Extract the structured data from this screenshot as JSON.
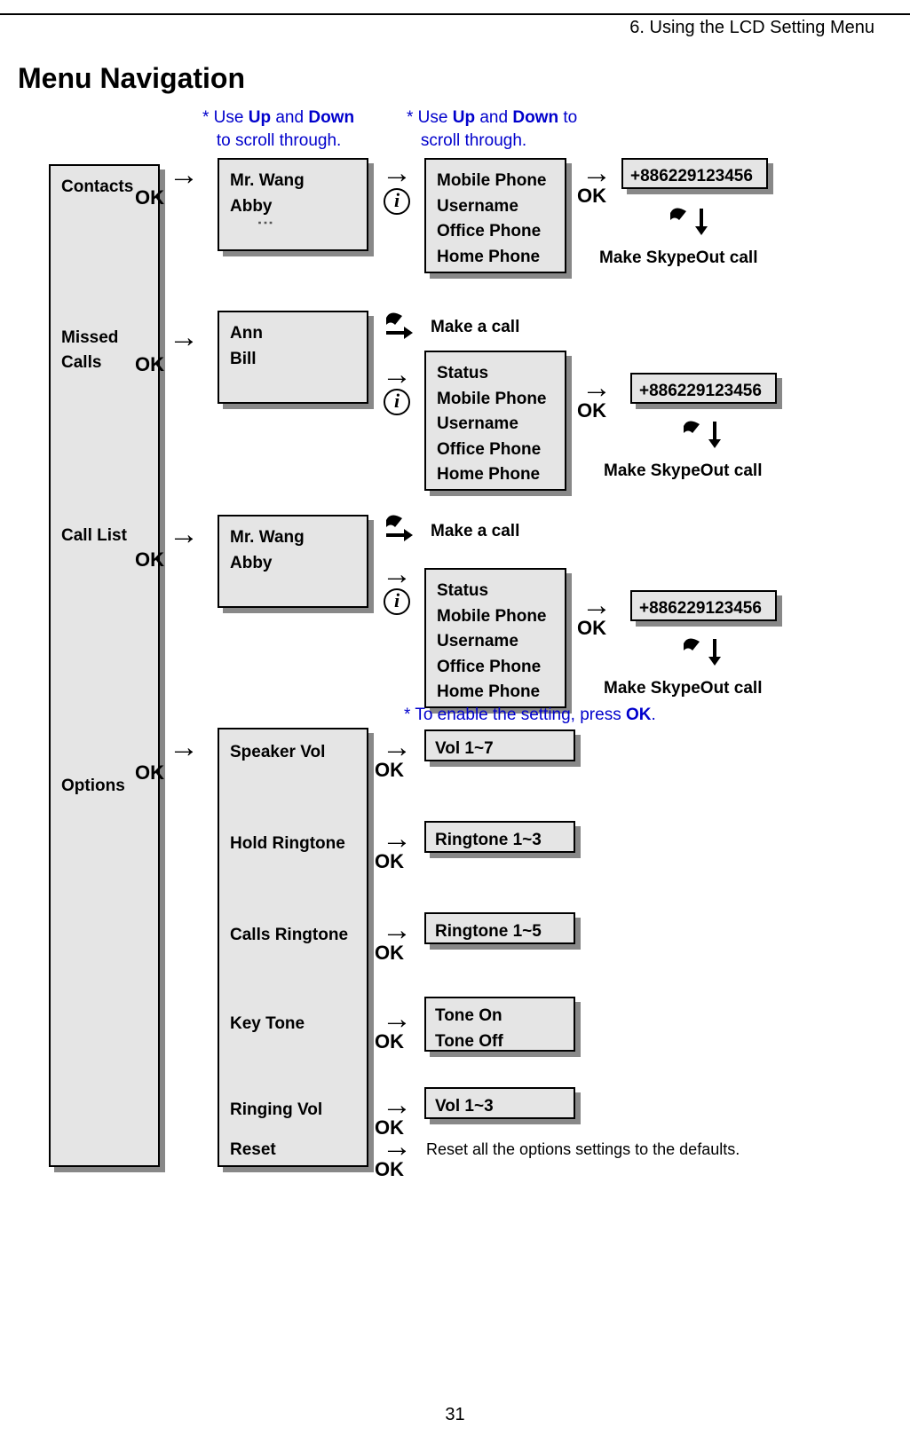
{
  "header": "6. Using the LCD Setting Menu",
  "title": "Menu Navigation",
  "page_number": "31",
  "notes": {
    "scroll1_pre": "*  Use ",
    "scroll1_up": "Up",
    "scroll1_and": " and ",
    "scroll1_down": "Down",
    "scroll1_post": "to scroll through.",
    "scroll2_pre": "*  Use ",
    "scroll2_up": "Up",
    "scroll2_and": " and ",
    "scroll2_down": "Down",
    "scroll2_to": " to",
    "scroll2_post": "scroll through.",
    "enable_pre": "* To enable the setting, press ",
    "enable_ok": "OK",
    "enable_post": "."
  },
  "ok_label": "OK",
  "menu": {
    "contacts": "Contacts",
    "missed_calls_l1": "Missed",
    "missed_calls_l2": "Calls",
    "call_list": "Call List",
    "options": "Options"
  },
  "row1": {
    "col2_l1": "Mr. Wang",
    "col2_l2": "Abby",
    "col3_l1": "Mobile Phone",
    "col3_l2": "Username",
    "col3_l3": "Office Phone",
    "col3_l4": "Home Phone",
    "phone": "+886229123456",
    "call": "Make SkypeOut call"
  },
  "row2": {
    "col2_l1": "Ann",
    "col2_l2": "Bill",
    "make_call": "Make a call",
    "col3_l1": "Status",
    "col3_l2": "Mobile Phone",
    "col3_l3": "Username",
    "col3_l4": "Office Phone",
    "col3_l5": "Home Phone",
    "phone": "+886229123456",
    "call": "Make SkypeOut call"
  },
  "row3": {
    "col2_l1": "Mr. Wang",
    "col2_l2": "Abby",
    "make_call": "Make a call",
    "col3_l1": "Status",
    "col3_l2": "Mobile Phone",
    "col3_l3": "Username",
    "col3_l4": "Office Phone",
    "col3_l5": "Home Phone",
    "phone": "+886229123456",
    "call": "Make SkypeOut call"
  },
  "options": {
    "speaker_vol": "Speaker Vol",
    "hold_ringtone": "Hold Ringtone",
    "calls_ringtone": "Calls Ringtone",
    "key_tone": "Key Tone",
    "ringing_vol": "Ringing Vol",
    "reset": "Reset",
    "vol17": "Vol 1~7",
    "ringtone13": "Ringtone 1~3",
    "ringtone15": "Ringtone 1~5",
    "tone_on": "Tone On",
    "tone_off": "Tone Off",
    "vol13": "Vol 1~3",
    "reset_text": "Reset all the options settings to the defaults."
  }
}
